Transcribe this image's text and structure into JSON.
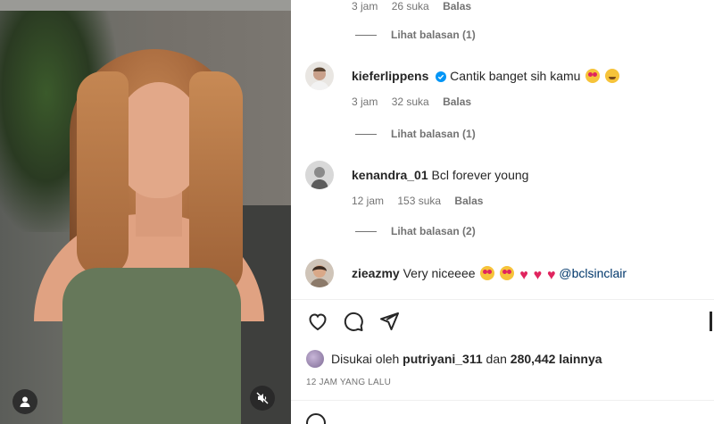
{
  "comments": [
    {
      "id": "c0",
      "username": "",
      "text": "",
      "time": "3 jam",
      "likes": "26 suka",
      "reply_label": "Balas",
      "view_replies": "Lihat balasan (1)"
    },
    {
      "id": "c1",
      "username": "kieferlippens",
      "verified": true,
      "text": "Cantik banget sih kamu",
      "emojis": [
        "smiling-face-with-heart-eyes",
        "grinning-face"
      ],
      "time": "3 jam",
      "likes": "32 suka",
      "reply_label": "Balas",
      "view_replies": "Lihat balasan (1)"
    },
    {
      "id": "c2",
      "username": "kenandra_01",
      "text": "Bcl forever young",
      "time": "12 jam",
      "likes": "153 suka",
      "reply_label": "Balas",
      "view_replies": "Lihat balasan (2)"
    },
    {
      "id": "c3",
      "username": "zieazmy",
      "text": "Very niceeee",
      "emojis": [
        "smiling-face-with-heart-eyes",
        "smiling-face-with-heart-eyes",
        "red-heart",
        "red-heart",
        "red-heart"
      ],
      "mention": "@bclsinclair"
    }
  ],
  "liked_by": {
    "prefix": "Disukai oleh",
    "user": "putriyani_311",
    "conjunction": "dan",
    "count": "280,442 lainnya"
  },
  "time_ago": "12 JAM YANG LALU",
  "icons": {
    "like": "heart-outline-icon",
    "comment": "comment-bubble-icon",
    "share": "paper-plane-icon",
    "user": "user-tag-icon",
    "mute": "speaker-muted-icon",
    "emoji": "emoji-smiley-icon"
  },
  "colors": {
    "mention": "#00376b",
    "verified": "#0095f6",
    "meta": "#737373",
    "heart_red": "#e0245e"
  }
}
